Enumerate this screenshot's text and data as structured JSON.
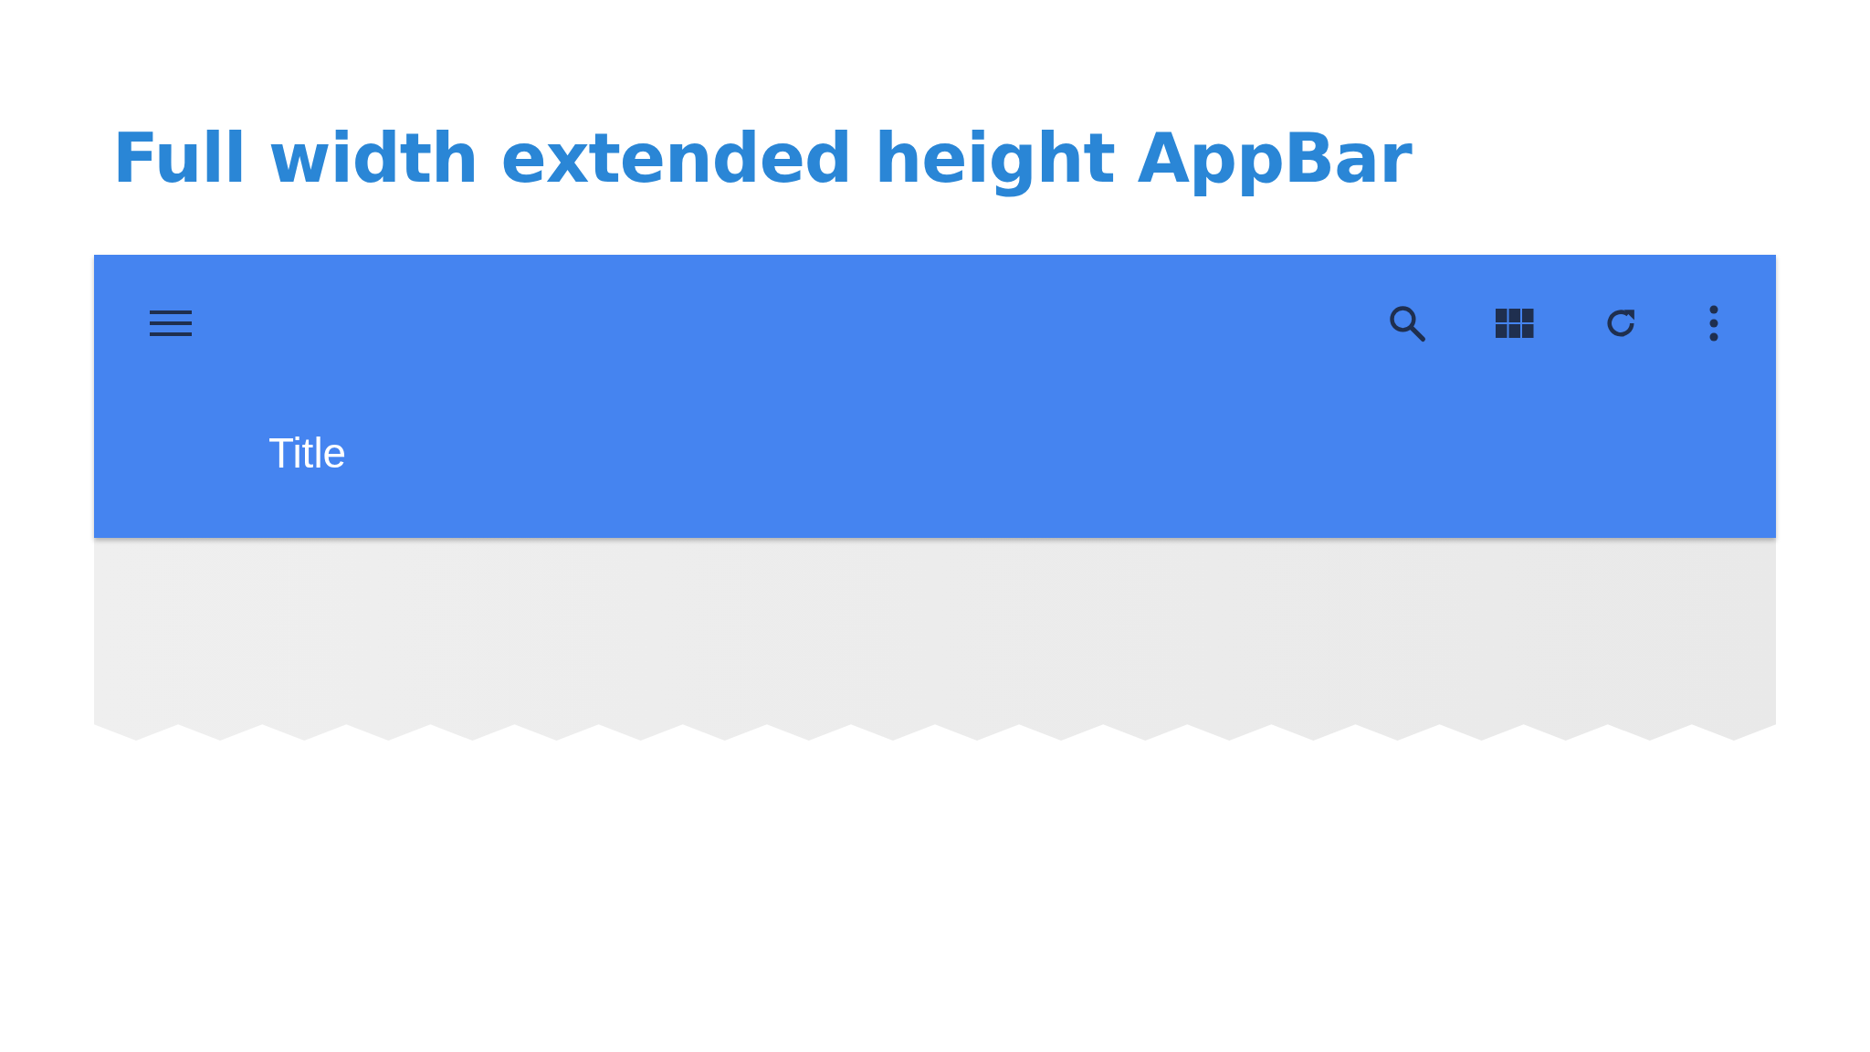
{
  "slide_title": "Full width extended height AppBar",
  "app_bar": {
    "title": "Title"
  }
}
